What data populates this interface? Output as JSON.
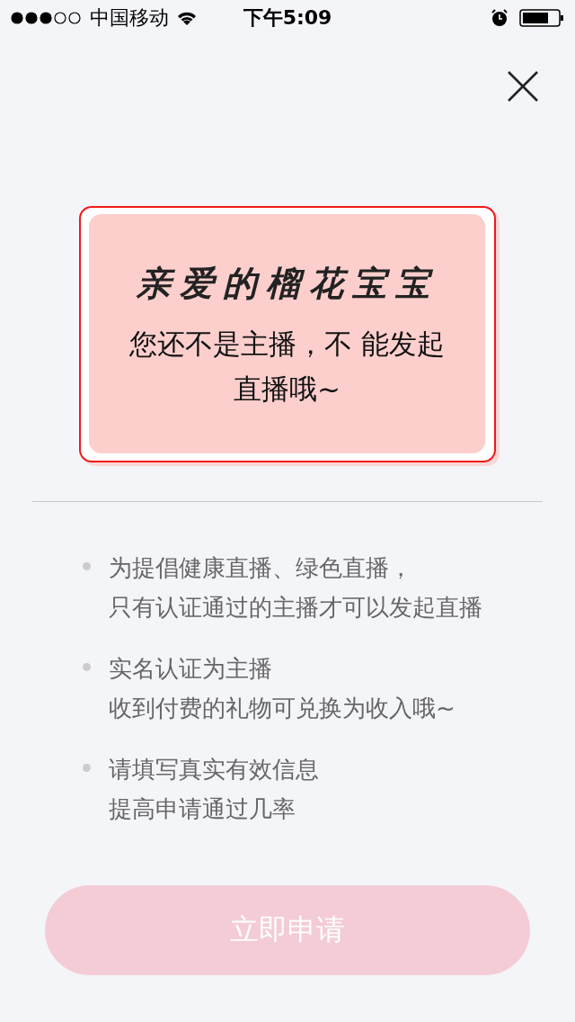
{
  "status_bar": {
    "carrier": "中国移动",
    "time": "下午5:09"
  },
  "card": {
    "title": "亲爱的榴花宝宝",
    "message": "您还不是主播，不 能发起直播哦~"
  },
  "tips": [
    {
      "lines": [
        "为提倡健康直播、绿色直播，",
        "只有认证通过的主播才可以发起直播"
      ]
    },
    {
      "lines": [
        "实名认证为主播",
        "收到付费的礼物可兑换为收入哦~"
      ]
    },
    {
      "lines": [
        "请填写真实有效信息",
        "提高申请通过几率"
      ]
    }
  ],
  "apply_button": {
    "label": "立即申请",
    "disabled": true
  }
}
